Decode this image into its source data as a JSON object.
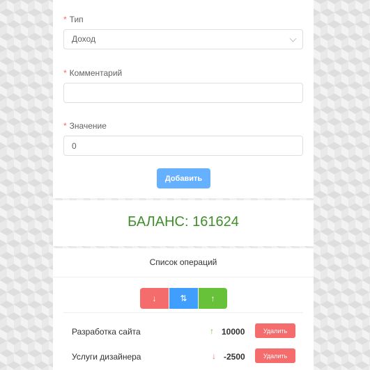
{
  "form": {
    "type_label": "Тип",
    "type_value": "Доход",
    "comment_label": "Комментарий",
    "comment_value": "",
    "value_label": "Значение",
    "value_value": "0",
    "required_mark": "*",
    "add_button": "Добавить"
  },
  "balance": {
    "text": "БАЛАНС: 161624"
  },
  "operations": {
    "title": "Список операций",
    "filter_buttons": [
      {
        "icon": "arrow-down-icon",
        "glyph": "↓"
      },
      {
        "icon": "sort-icon",
        "glyph": "⇅"
      },
      {
        "icon": "arrow-up-icon",
        "glyph": "↑"
      }
    ],
    "items": [
      {
        "title": "Разработка сайта",
        "direction": "up",
        "arrow": "↑",
        "amount": "10000",
        "delete_label": "Удалить"
      },
      {
        "title": "Услуги дизайнера",
        "direction": "down",
        "arrow": "↓",
        "amount": "-2500",
        "delete_label": "Удалить"
      }
    ]
  },
  "colors": {
    "primary": "#66b1ff",
    "danger": "#f56c6c",
    "success": "#67c23a",
    "balance": "#3e8e2a"
  }
}
